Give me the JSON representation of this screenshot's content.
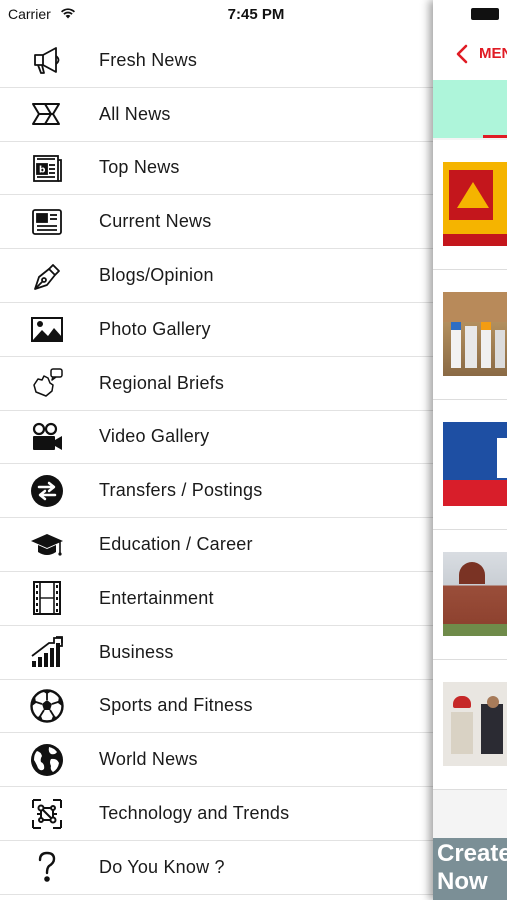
{
  "status_bar": {
    "carrier": "Carrier",
    "time": "7:45 PM"
  },
  "menu": {
    "items": [
      {
        "label": "Fresh News",
        "icon": "megaphone-icon"
      },
      {
        "label": "All News",
        "icon": "newspaper-fold-icon"
      },
      {
        "label": "Top News",
        "icon": "top-news-icon"
      },
      {
        "label": "Current News",
        "icon": "newspaper-icon"
      },
      {
        "label": "Blogs/Opinion",
        "icon": "fountain-pen-icon"
      },
      {
        "label": "Photo Gallery",
        "icon": "photo-icon"
      },
      {
        "label": "Regional Briefs",
        "icon": "map-speech-icon"
      },
      {
        "label": "Video Gallery",
        "icon": "video-camera-icon"
      },
      {
        "label": "Transfers / Postings",
        "icon": "swap-arrows-icon"
      },
      {
        "label": "Education / Career",
        "icon": "graduation-cap-icon"
      },
      {
        "label": "Entertainment",
        "icon": "film-strip-icon"
      },
      {
        "label": "Business",
        "icon": "bar-chart-icon"
      },
      {
        "label": "Sports and Fitness",
        "icon": "soccer-ball-icon"
      },
      {
        "label": "World News",
        "icon": "globe-icon"
      },
      {
        "label": "Technology and Trends",
        "icon": "circuit-icon"
      },
      {
        "label": "Do You Know ?",
        "icon": "question-mark-icon"
      }
    ]
  },
  "background_app": {
    "nav_label": "MENU",
    "bottom_banner": "Create\nNow",
    "colors": {
      "accent": "#e01b24",
      "tab_bar": "#aef5da",
      "banner": "#7b8f96"
    }
  }
}
